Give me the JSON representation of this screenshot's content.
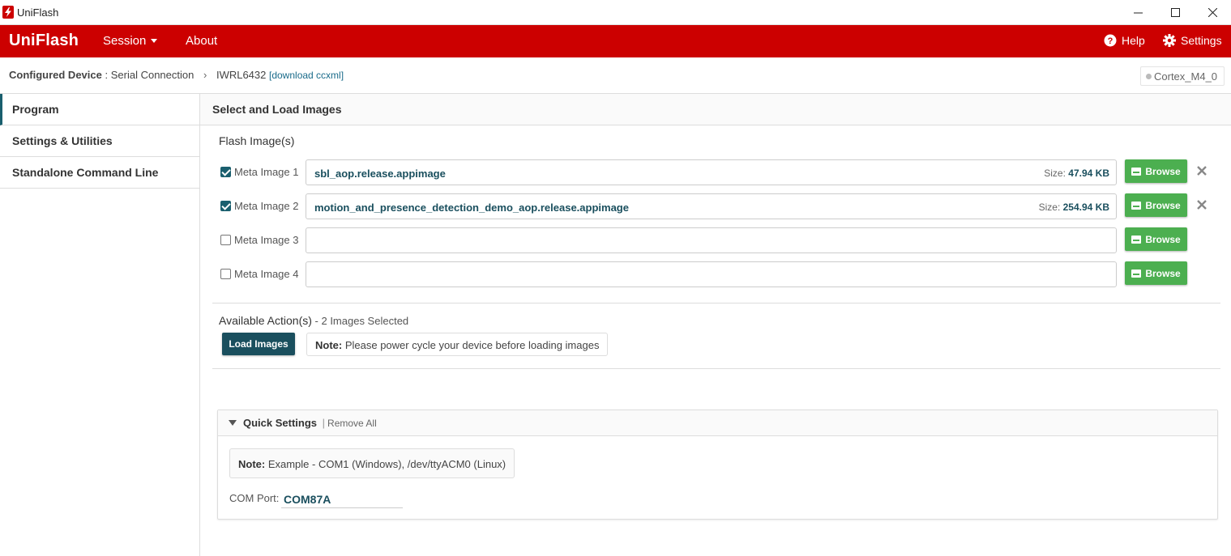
{
  "window": {
    "title": "UniFlash"
  },
  "header": {
    "brand": "UniFlash",
    "nav": {
      "session": "Session",
      "about": "About"
    },
    "help": "Help",
    "settings": "Settings",
    "accent_color": "#cc0000"
  },
  "breadcrumb": {
    "label": "Configured Device",
    "sep": ":",
    "connection": "Serial Connection",
    "device": "IWRL6432",
    "download_link": "[download ccxml]",
    "core": "Cortex_M4_0"
  },
  "sidebar": {
    "items": [
      {
        "label": "Program",
        "active": true
      },
      {
        "label": "Settings & Utilities",
        "active": false
      },
      {
        "label": "Standalone Command Line",
        "active": false
      }
    ]
  },
  "main": {
    "panel_title": "Select and Load Images",
    "flash_title": "Flash Image(s)",
    "size_label": "Size:",
    "browse_label": "Browse",
    "images": [
      {
        "label": "Meta Image 1",
        "checked": true,
        "file": "sbl_aop.release.appimage",
        "size": "47.94 KB"
      },
      {
        "label": "Meta Image 2",
        "checked": true,
        "file": "motion_and_presence_detection_demo_aop.release.appimage",
        "size": "254.94 KB"
      },
      {
        "label": "Meta Image 3",
        "checked": false,
        "file": "",
        "size": ""
      },
      {
        "label": "Meta Image 4",
        "checked": false,
        "file": "",
        "size": ""
      }
    ],
    "actions_title": "Available Action(s)",
    "actions_count": " - 2 Images Selected",
    "load_button": "Load Images",
    "note_label": "Note:",
    "note_text": " Please power cycle your device before loading images"
  },
  "quick_settings": {
    "title": "Quick Settings",
    "separator": "|",
    "remove_all": "Remove All",
    "note_label": "Note:",
    "note_text": " Example - COM1 (Windows), /dev/ttyACM0 (Linux)",
    "com_label": "COM Port:",
    "com_value": "COM87A"
  }
}
